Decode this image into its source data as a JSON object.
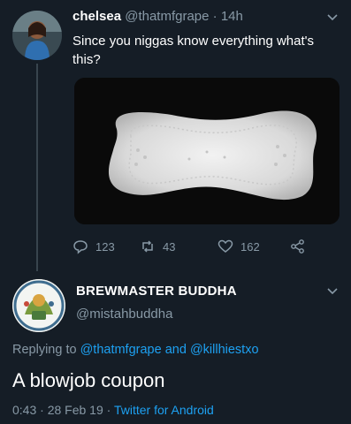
{
  "tweet1": {
    "name": "chelsea",
    "handle": "@thatmfgrape",
    "separator": "·",
    "time": "14h",
    "text": "Since you niggas know everything what's this?",
    "media_alt": "sanitary pad photo",
    "actions": {
      "replies": "123",
      "retweets": "43",
      "likes": "162"
    }
  },
  "tweet2": {
    "name": "BREWMASTER BUDDHA",
    "handle": "@mistahbuddha",
    "replying_prefix": "Replying to",
    "replying_user1": "@thatmfgrape",
    "replying_and": "and",
    "replying_user2": "@killhiestxo",
    "text": "A blowjob coupon",
    "time": "0:43",
    "date": "28 Feb 19",
    "source": "Twitter for Android"
  },
  "colors": {
    "background": "#151d26",
    "muted": "#8899a6",
    "accent": "#1da1f2"
  },
  "icons": [
    "chevron-down-icon",
    "reply-icon",
    "retweet-icon",
    "like-icon",
    "share-icon"
  ]
}
